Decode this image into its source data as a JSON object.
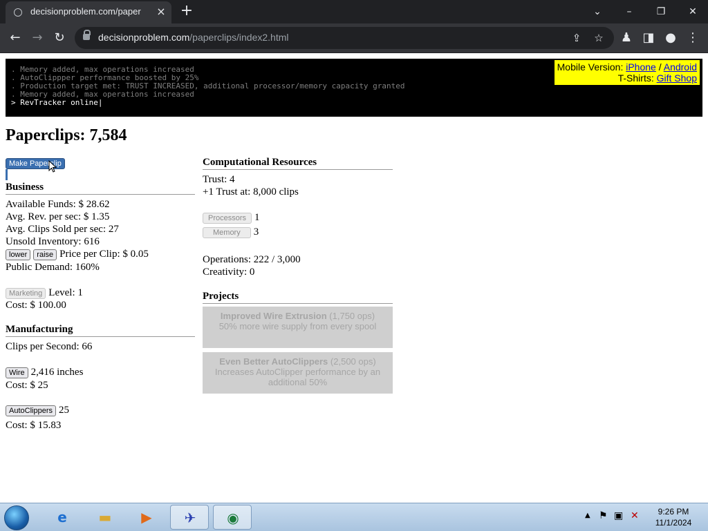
{
  "browser": {
    "tab_title": "decisionproblem.com/paperclips",
    "url_host": "decisionproblem.com",
    "url_path": "/paperclips/index2.html"
  },
  "console": {
    "lines": [
      ". Memory added, max operations increased",
      ". AutoClippper performance boosted by 25%",
      ". Production target met: TRUST INCREASED, additional processor/memory capacity granted",
      ". Memory added, max operations increased"
    ],
    "active_line": "> RevTracker online|"
  },
  "promo": {
    "mobile_label": "Mobile Version:",
    "iphone": "iPhone",
    "sep": "/",
    "android": "Android",
    "tshirts_label": "T-Shirts:",
    "gift_shop": "Gift Shop"
  },
  "clips_title": "Paperclips: 7,584",
  "make_button": "Make Paperclip",
  "business": {
    "heading": "Business",
    "funds": "Available Funds: $ 28.62",
    "avg_rev": "Avg. Rev. per sec: $ 1.35",
    "avg_clips": "Avg. Clips Sold per sec: 27",
    "unsold": "Unsold Inventory: 616",
    "lower": "lower",
    "raise": "raise",
    "price": "Price per Clip: $ 0.05",
    "demand": "Public Demand: 160%",
    "marketing_button": "Marketing",
    "marketing_level": "Level: 1",
    "marketing_cost": "Cost: $ 100.00"
  },
  "manufacturing": {
    "heading": "Manufacturing",
    "clips_per_sec": "Clips per Second: 66",
    "wire_button": "Wire",
    "wire_amount": "2,416 inches",
    "wire_cost": "Cost: $ 25",
    "autoclippers_button": "AutoClippers",
    "autoclippers_count": "25",
    "autoclippers_cost": "Cost: $ 15.83"
  },
  "computational": {
    "heading": "Computational Resources",
    "trust": "Trust: 4",
    "next_trust": "+1 Trust at: 8,000 clips",
    "processors_button": "Processors",
    "processors_value": "1",
    "memory_button": "Memory",
    "memory_value": "3",
    "operations": "Operations: 222 / 3,000",
    "creativity": "Creativity: 0"
  },
  "projects": {
    "heading": "Projects",
    "items": [
      {
        "title": "Improved Wire Extrusion",
        "cost": "(1,750 ops)",
        "desc": "50% more wire supply from every spool"
      },
      {
        "title": "Even Better AutoClippers",
        "cost": "(2,500 ops)",
        "desc": "Increases AutoClipper performance by an additional 50%"
      }
    ]
  },
  "taskbar": {
    "time": "9:26 PM",
    "date": "11/1/2024"
  }
}
